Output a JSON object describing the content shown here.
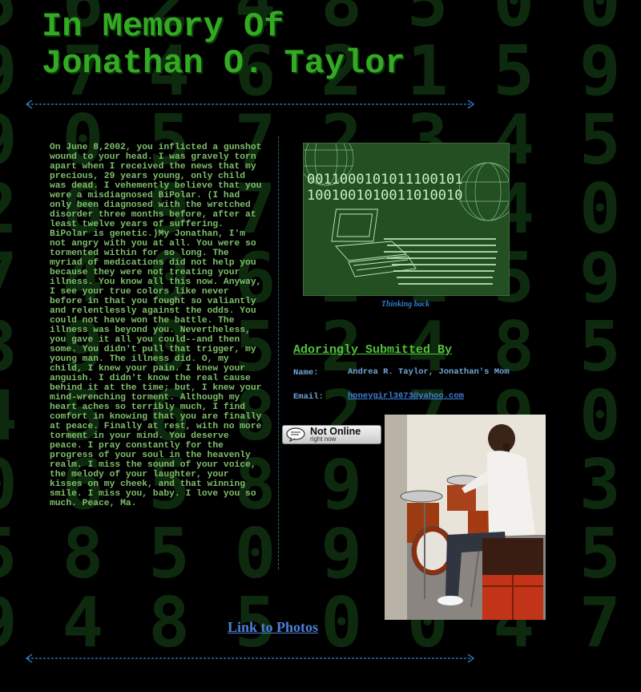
{
  "page": {
    "title_line1": "In Memory Of",
    "title_line2": "Jonathan O. Taylor"
  },
  "background_digits": [
    "5 6 2 4 8 5 0 0 3 9 4 8 5 1 2 6",
    "9 7 4 6 2 1 5 9 4 8 7 0 6 2 5 4",
    "9 0 5 7 2 3 4 5 8 1 0 3 7 1 1",
    "2 6 9 7 8 5 4 0 9 4 8 5 0 2 6",
    "7 4 0 6 2 1 5 9 3 8 7 0 6 2 5",
    "3 9 0 5 2 4 8 5 0 9 4 8 5 0 8",
    "4 5 6 8 2 7 9 0 5 2 3 4 4 7 1",
    "0 6 5 8 9 7 2 3 1 6 0 5 9 2 8",
    "5 8 5 0 9 4 8 5 0 3 9 4 8 5 1",
    "9 4 8 5 0 0 4 7 9 3 4 5 2 6 7"
  ],
  "story": {
    "text": "On June 8,2002, you inflicted a gunshot wound to your head. I was gravely torn apart when I received the news that my precious, 29 years young, only child was dead. I vehemently believe that you were a misdiagnosed BiPolar. (I had only been diagnosed with the wretched disorder three months before, after at least twelve years of suffering. BiPolar is genetic.)My Jonathan, I'm not angry with you at all. You were so tormented within for so long. The myriad of medications did not help you because they were not treating your illness. You know all this now. Anyway, I see your true colors like never before in that you fought so valiantly and relentlessly against the odds. You could not have won the battle. The illness was beyond you. Nevertheless, you gave it all you could--and then some. You didn't pull that trigger, my young man. The illness did. O, my child, I knew your pain. I knew your anguish. I didn't know the real cause behind it at the time; but, I knew your mind-wrenching torment. Although my heart aches so terribly much, I find comfort in knowing that you are finally at peace. Finally at rest, with no more torment in your mind. You deserve peace. I pray constantly for the progress of your soul in the heavenly realm. I miss the sound of your voice, the melody of your laughter, your kisses on my cheek, and that winning smile. I miss you, baby. I love you so much. Peace, Ma."
  },
  "hero_image": {
    "binary_line1": "0011000101011100101",
    "binary_line2": "1001001010011010010",
    "caption": "Thinking back"
  },
  "submitted": {
    "heading": "Adoringly Submitted By",
    "name_label": "Name:",
    "name_value": "Andrea R. Taylor, Jonathan's Mom",
    "email_label": "Email:",
    "email_value": "honeygirl3673@yahoo.com"
  },
  "status": {
    "main": "Not Online",
    "sub": "right now",
    "icon": "chat-bubble-icon"
  },
  "photo": {
    "alt": "Jonathan playing drums"
  },
  "links": {
    "photos": "Link to Photos"
  },
  "colors": {
    "title": "#33aa22",
    "body_text": "#7fbf6a",
    "link": "#4d7fd6",
    "divider": "#2b6fae"
  }
}
